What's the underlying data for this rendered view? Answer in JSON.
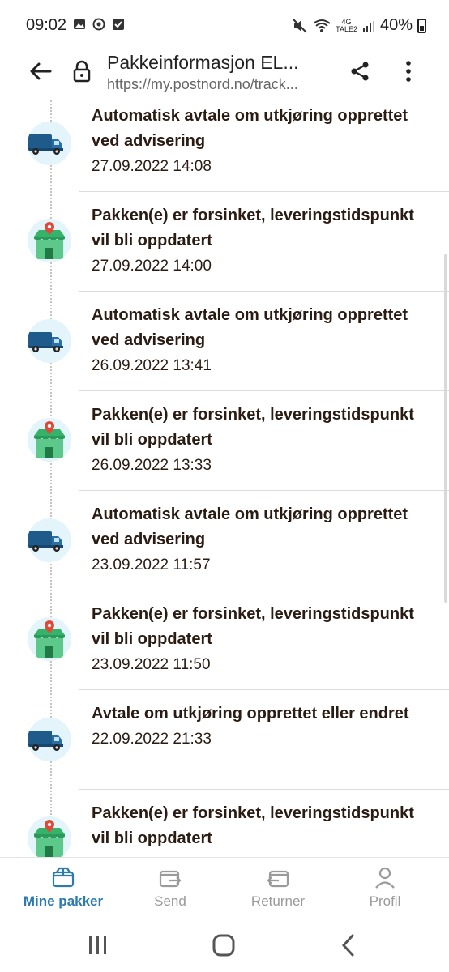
{
  "status_bar": {
    "time": "09:02",
    "battery": "40%",
    "network_label": "4G",
    "network_sublabel": "TALE2"
  },
  "browser": {
    "title": "Pakkeinformasjon EL...",
    "url": "https://my.postnord.no/track..."
  },
  "events": [
    {
      "type": "delivery",
      "title": "Automatisk avtale om utkjøring opprettet ved advisering",
      "date": "27.09.2022 14:08"
    },
    {
      "type": "delay",
      "title": "Pakken(e) er forsinket, leveringstidspunkt vil bli oppdatert",
      "date": "27.09.2022 14:00"
    },
    {
      "type": "delivery",
      "title": "Automatisk avtale om utkjøring opprettet ved advisering",
      "date": "26.09.2022 13:41"
    },
    {
      "type": "delay",
      "title": "Pakken(e) er forsinket, leveringstidspunkt vil bli oppdatert",
      "date": "26.09.2022 13:33"
    },
    {
      "type": "delivery",
      "title": "Automatisk avtale om utkjøring opprettet ved advisering",
      "date": "23.09.2022 11:57"
    },
    {
      "type": "delay",
      "title": "Pakken(e) er forsinket, leveringstidspunkt vil bli oppdatert",
      "date": "23.09.2022 11:50"
    },
    {
      "type": "delivery",
      "title": "Avtale om utkjøring opprettet eller endret",
      "date": "22.09.2022 21:33"
    },
    {
      "type": "delay",
      "title": "Pakken(e) er forsinket, leveringstidspunkt vil bli oppdatert",
      "date": ""
    }
  ],
  "bottom_nav": {
    "items": [
      {
        "label": "Mine pakker",
        "icon": "parcel-icon",
        "active": true
      },
      {
        "label": "Send",
        "icon": "send-parcel-icon",
        "active": false
      },
      {
        "label": "Returner",
        "icon": "return-parcel-icon",
        "active": false
      },
      {
        "label": "Profil",
        "icon": "profile-icon",
        "active": false
      }
    ]
  },
  "colors": {
    "accent": "#2b7ab0",
    "text": "#2a1b13",
    "truck": "#1e5a8a",
    "pin": "#e0493a",
    "store_green": "#35b36b",
    "icon_bg": "#e3f4fb"
  }
}
